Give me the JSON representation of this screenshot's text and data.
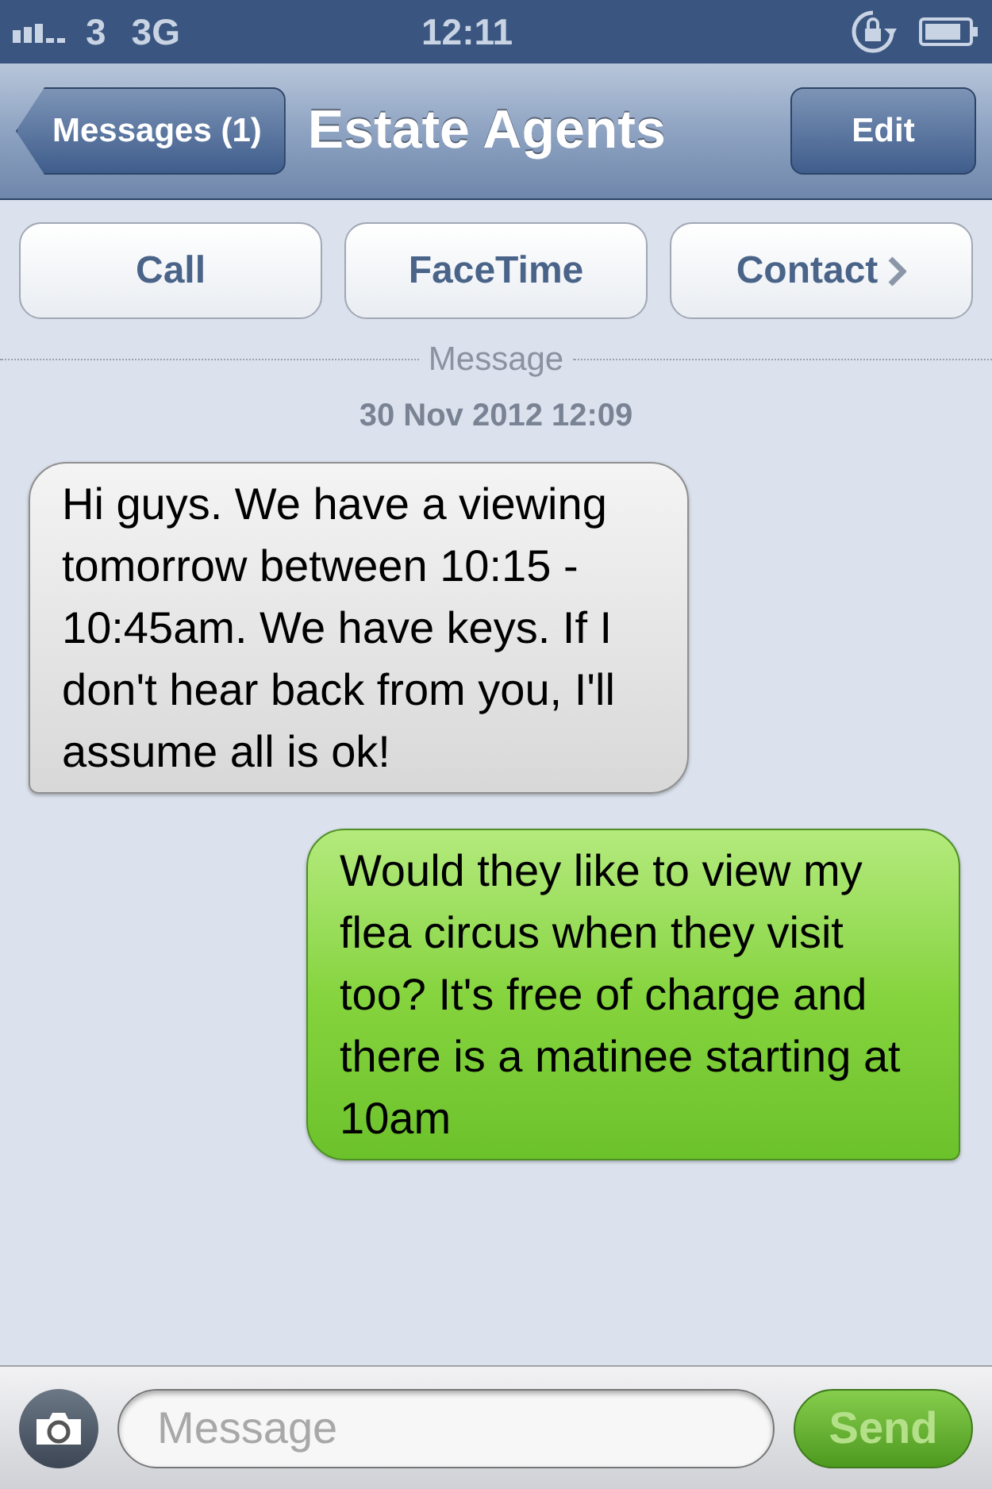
{
  "status_bar": {
    "carrier": "3",
    "network": "3G",
    "time": "12:11"
  },
  "nav_bar": {
    "back": "Messages (1)",
    "title": "Estate Agents",
    "edit": "Edit"
  },
  "actions": [
    {
      "label": "Call",
      "chevron": false
    },
    {
      "label": "FaceTime",
      "chevron": false
    },
    {
      "label": "Contact",
      "chevron": true
    }
  ],
  "thread": {
    "service": "Message",
    "timestamp": "30 Nov 2012 12:09"
  },
  "messages": [
    {
      "kind": "received",
      "text": "Hi guys. We have a viewing tomorrow between 10:15 - 10:45am. We have keys. If I don't hear back from you, I'll assume all is ok!"
    },
    {
      "kind": "sent",
      "text": "Would they like to view my flea circus when they visit too? It's free of charge and there is a matinee starting at 10am"
    }
  ],
  "composer": {
    "placeholder": "Message",
    "send": "Send",
    "send_disabled": true
  }
}
